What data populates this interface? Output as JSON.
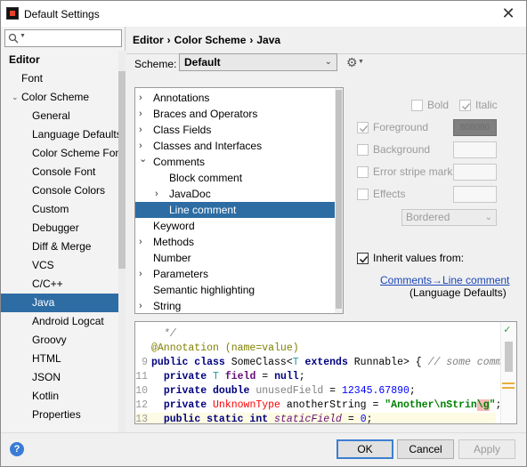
{
  "window": {
    "title": "Default Settings",
    "close_glyph": "✕"
  },
  "sidebar": {
    "search_placeholder": "",
    "items": [
      {
        "label": "Editor",
        "level": 0,
        "bold": true
      },
      {
        "label": "Font",
        "level": 1
      },
      {
        "label": "Color Scheme",
        "level": 1,
        "expanded": true
      },
      {
        "label": "General",
        "level": 2
      },
      {
        "label": "Language Defaults",
        "level": 2
      },
      {
        "label": "Color Scheme Font",
        "level": 2
      },
      {
        "label": "Console Font",
        "level": 2
      },
      {
        "label": "Console Colors",
        "level": 2
      },
      {
        "label": "Custom",
        "level": 2
      },
      {
        "label": "Debugger",
        "level": 2
      },
      {
        "label": "Diff & Merge",
        "level": 2
      },
      {
        "label": "VCS",
        "level": 2
      },
      {
        "label": "C/C++",
        "level": 2
      },
      {
        "label": "Java",
        "level": 2,
        "selected": true
      },
      {
        "label": "Android Logcat",
        "level": 2
      },
      {
        "label": "Groovy",
        "level": 2
      },
      {
        "label": "HTML",
        "level": 2
      },
      {
        "label": "JSON",
        "level": 2
      },
      {
        "label": "Kotlin",
        "level": 2
      },
      {
        "label": "Properties",
        "level": 2
      }
    ]
  },
  "breadcrumb": {
    "parts": [
      "Editor",
      "Color Scheme",
      "Java"
    ],
    "separator": "›"
  },
  "scheme": {
    "label": "Scheme:",
    "value": "Default"
  },
  "categories": [
    {
      "label": "Annotations",
      "indent": 0,
      "arrow": "›"
    },
    {
      "label": "Braces and Operators",
      "indent": 0,
      "arrow": "›"
    },
    {
      "label": "Class Fields",
      "indent": 0,
      "arrow": "›"
    },
    {
      "label": "Classes and Interfaces",
      "indent": 0,
      "arrow": "›"
    },
    {
      "label": "Comments",
      "indent": 0,
      "arrow": "⌄"
    },
    {
      "label": "Block comment",
      "indent": 1,
      "arrow": ""
    },
    {
      "label": "JavaDoc",
      "indent": 1,
      "arrow": "›"
    },
    {
      "label": "Line comment",
      "indent": 1,
      "arrow": "",
      "selected": true
    },
    {
      "label": "Keyword",
      "indent": 0,
      "arrow": ""
    },
    {
      "label": "Methods",
      "indent": 0,
      "arrow": "›"
    },
    {
      "label": "Number",
      "indent": 0,
      "arrow": ""
    },
    {
      "label": "Parameters",
      "indent": 0,
      "arrow": "›"
    },
    {
      "label": "Semantic highlighting",
      "indent": 0,
      "arrow": ""
    },
    {
      "label": "String",
      "indent": 0,
      "arrow": "›"
    }
  ],
  "attributes": {
    "bold_label": "Bold",
    "italic_label": "Italic",
    "foreground_label": "Foreground",
    "foreground_value": "808080",
    "background_label": "Background",
    "error_stripe_label": "Error stripe mark",
    "effects_label": "Effects",
    "effects_type": "Bordered",
    "inherit_label": "Inherit values from:",
    "inherit_link": "Comments→Line comment",
    "inherit_source": "(Language Defaults)"
  },
  "preview": {
    "lines": [
      {
        "num": "",
        "text": "  */"
      },
      {
        "num": "",
        "text": "@Annotation (name=value)"
      },
      {
        "num": "9",
        "text": "public class SomeClass<T extends Runnable> { // some comment"
      },
      {
        "num": "11",
        "text": "  private T field = null;"
      },
      {
        "num": "10",
        "text": "  private double unusedField = 12345.67890;"
      },
      {
        "num": "12",
        "text": "  private UnknownType anotherString = \"Another\\nStrin\\g\";"
      },
      {
        "num": "13",
        "text": "  public static int staticField = 0;"
      }
    ]
  },
  "buttons": {
    "ok": "OK",
    "cancel": "Cancel",
    "apply": "Apply",
    "help": "?"
  },
  "colors": {
    "selection": "#2e6da4",
    "link": "#1a46b8",
    "primary_border": "#3c7fd1"
  }
}
